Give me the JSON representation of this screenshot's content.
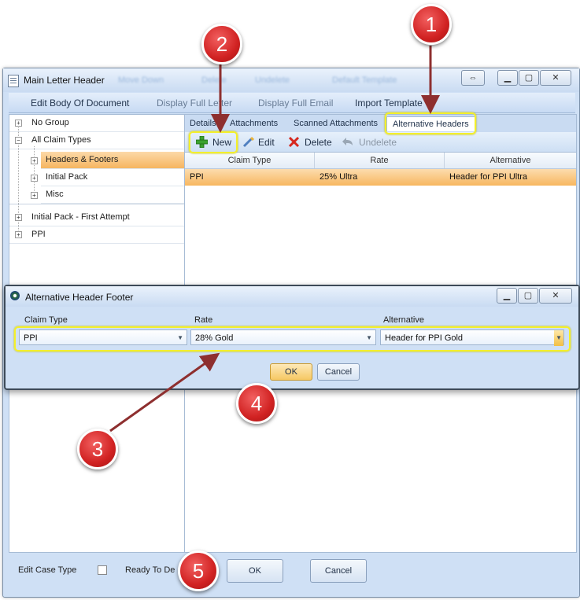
{
  "window": {
    "title": "Main Letter Header",
    "ghost_items": [
      "Move Down",
      "Delete",
      "Undelete",
      "Default Template"
    ],
    "controls": {
      "resize": "⇔",
      "minimize": "▁",
      "maximize": "▢",
      "close": "✕"
    }
  },
  "command_bar": {
    "items": [
      "Edit Body Of Document",
      "Display Full Letter",
      "Display Full Email",
      "Import Template"
    ]
  },
  "tree": {
    "items": [
      {
        "label": "No Group"
      },
      {
        "label": "All Claim Types"
      },
      {
        "label": "Headers & Footers",
        "selected": true
      },
      {
        "label": "Initial Pack"
      },
      {
        "label": "Misc"
      },
      {
        "label": "Initial  Pack - First Attempt"
      },
      {
        "label": "PPI"
      }
    ]
  },
  "tabs": [
    "Details",
    "Attachments",
    "Scanned Attachments",
    "Alternative Headers"
  ],
  "toolbar": {
    "new": "New",
    "edit": "Edit",
    "delete": "Delete",
    "undelete": "Undelete"
  },
  "grid": {
    "columns": [
      "Claim Type",
      "Rate",
      "Alternative"
    ],
    "rows": [
      [
        "PPI",
        "25% Ultra",
        "Header for PPI Ultra"
      ]
    ]
  },
  "dialog": {
    "title": "Alternative Header Footer",
    "labels": {
      "claim_type": "Claim Type",
      "rate": "Rate",
      "alternative": "Alternative"
    },
    "values": {
      "claim_type": "PPI",
      "rate": "28% Gold",
      "alternative": "Header for PPI Gold"
    },
    "ok": "OK",
    "cancel": "Cancel"
  },
  "bottom": {
    "edit_case_type": "Edit Case Type",
    "ready_to": "Ready To De",
    "ok": "OK",
    "cancel": "Cancel"
  },
  "callouts": [
    "1",
    "2",
    "3",
    "4",
    "5"
  ],
  "colors": {
    "callout": "#d12222",
    "highlight": "#f3ef2b",
    "selection": "#f7b760"
  }
}
